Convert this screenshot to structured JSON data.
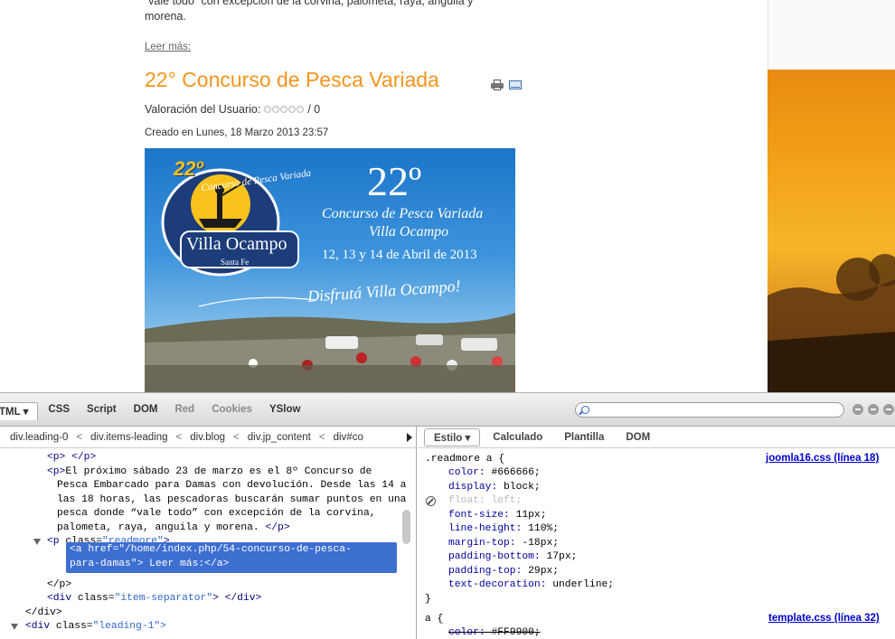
{
  "article_prev": {
    "intro_line1": "“vale todo” con excepción de la corvina, palometa, raya, anguila y",
    "intro_line2": "morena.",
    "readmore_label": "Leer más:"
  },
  "article": {
    "title": "22° Concurso de Pesca Variada",
    "rating_label": "Valoración del Usuario:",
    "rating_value": "/ 0",
    "rating_stars": 0,
    "rating_max": 5,
    "created": "Creado en Lunes, 18 Marzo 2013 23:57",
    "poster": {
      "number": "22º",
      "line1": "Concurso de Pesca Variada",
      "line2": "Villa Ocampo",
      "dates": "12, 13 y 14 de Abril de 2013",
      "slogan": "Disfrutá Villa Ocampo!",
      "logo_number": "22º",
      "logo_arc": "Concurso de Pesca Variada",
      "logo_name": "Villa Ocampo",
      "logo_sub": "Santa Fe"
    },
    "icons": [
      "print-icon",
      "email-icon"
    ]
  },
  "firebug": {
    "tabs": [
      {
        "label": "TML ▾",
        "active": true
      },
      {
        "label": "CSS",
        "active": false
      },
      {
        "label": "Script",
        "active": false
      },
      {
        "label": "DOM",
        "active": false
      },
      {
        "label": "Red",
        "active": false
      },
      {
        "label": "Cookies",
        "active": false
      },
      {
        "label": "YSlow",
        "active": false
      }
    ],
    "search_placeholder": "",
    "breadcrumbs": [
      "div.leading-0",
      "<",
      "div.items-leading",
      "<",
      "div.blog",
      "<",
      "div.jp_content",
      "<",
      "div#co"
    ],
    "html": {
      "p_empty_open": "<p>",
      "p_empty_close": "</p>",
      "p_open": "<p>",
      "p_text1": "El próximo sábado 23 de marzo es el 8º Concurso de",
      "p_text2": "Pesca Embarcado para Damas con devolución. Desde las 14 a",
      "p_text3": "las 18 horas, las pescadoras buscarán sumar puntos en una",
      "p_text4": "pesca donde “vale todo” con excepción de la corvina,",
      "p_text5": "palometa, raya, anguila y morena.",
      "p_close": "</p>",
      "readmore_tag": "<p",
      "readmore_attr": "class=",
      "readmore_val": "\"readmore\"",
      "selected_line1": "<a href=\"/home/index.php/54-concurso-de-pesca-",
      "selected_line2": "para-damas\">  Leer más:</a>",
      "p_close2": "</p>",
      "sep_tag": "<div",
      "sep_attr": "class=",
      "sep_val": "\"item-separator\"",
      "sep_close": "> </div>",
      "div_close": "</div>",
      "leading1_tag": "<div",
      "leading1_attr": "class=",
      "leading1_val": "\"leading-1\">"
    },
    "side_tabs": [
      {
        "label": "Estilo ▾",
        "active": true
      },
      {
        "label": "Calculado",
        "active": false
      },
      {
        "label": "Plantilla",
        "active": false
      },
      {
        "label": "DOM",
        "active": false
      }
    ],
    "css": {
      "rule1_selector": ".readmore a {",
      "rule1_source": "joomla16.css (línea 18)",
      "props": [
        {
          "name": "color:",
          "value": "#666666;"
        },
        {
          "name": "display:",
          "value": "block;"
        },
        {
          "name": "float:",
          "value": "left;"
        },
        {
          "name": "font-size:",
          "value": "11px;"
        },
        {
          "name": "line-height:",
          "value": "110%;"
        },
        {
          "name": "margin-top:",
          "value": "-18px;"
        },
        {
          "name": "padding-bottom:",
          "value": "17px;"
        },
        {
          "name": "padding-top:",
          "value": "29px;"
        },
        {
          "name": "text-decoration:",
          "value": "underline;"
        }
      ],
      "rule1_close": "}",
      "rule2_selector": "a {",
      "rule2_source": "template.css (línea 32)",
      "rule2_prop": "color:",
      "rule2_value": "#FF9900;"
    }
  },
  "colors": {
    "title_orange": "#f7941d",
    "selection_blue": "#3d6fd1",
    "link_blue": "#0000cc"
  }
}
